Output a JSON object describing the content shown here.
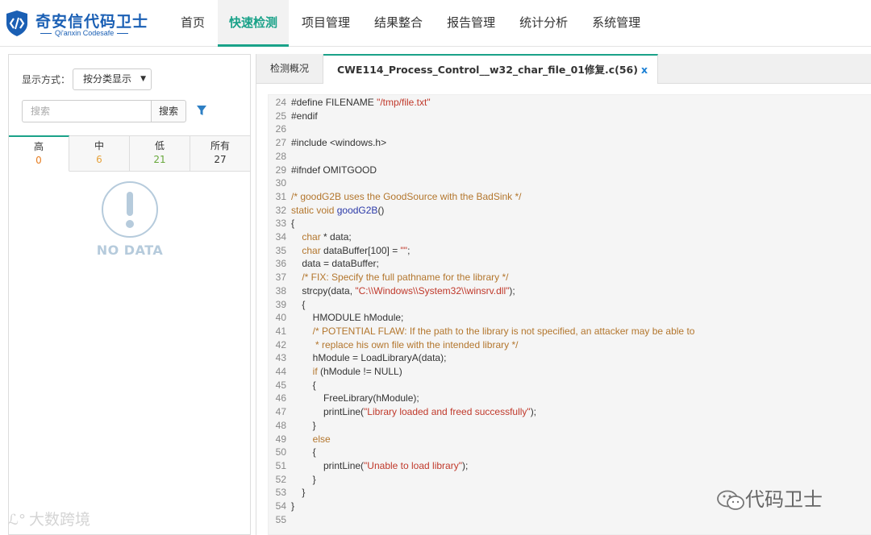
{
  "app": {
    "title": "奇安信代码卫士",
    "subtitle": "Qi'anxin Codesafe"
  },
  "nav": {
    "items": [
      "首页",
      "快速检测",
      "项目管理",
      "结果整合",
      "报告管理",
      "统计分析",
      "系统管理"
    ],
    "active_index": 1
  },
  "left": {
    "display_label": "显示方式：",
    "display_value": "按分类显示",
    "search_placeholder": "搜索",
    "search_button": "搜索",
    "severity_tabs": [
      {
        "label": "高",
        "count": "0",
        "color": "#e67e22"
      },
      {
        "label": "中",
        "count": "6",
        "color": "#e6a23c"
      },
      {
        "label": "低",
        "count": "21",
        "color": "#67a83a"
      },
      {
        "label": "所有",
        "count": "27",
        "color": "#333333"
      }
    ],
    "nodata_text": "NO DATA"
  },
  "tabs": {
    "overview": "检测概况",
    "file_tab": "CWE114_Process_Control__w32_char_file_01修复.c(56)",
    "close": "x"
  },
  "code": {
    "lines": [
      {
        "n": "24",
        "t": "#define FILENAME \"/tmp/file.txt\""
      },
      {
        "n": "25",
        "t": "#endif"
      },
      {
        "n": "26",
        "t": ""
      },
      {
        "n": "27",
        "t": "#include <windows.h>"
      },
      {
        "n": "28",
        "t": ""
      },
      {
        "n": "29",
        "t": "#ifndef OMITGOOD"
      },
      {
        "n": "30",
        "t": ""
      },
      {
        "n": "31",
        "t": "/* goodG2B uses the GoodSource with the BadSink */"
      },
      {
        "n": "32",
        "t": "static void goodG2B()"
      },
      {
        "n": "33",
        "t": "{"
      },
      {
        "n": "34",
        "t": "    char * data;"
      },
      {
        "n": "35",
        "t": "    char dataBuffer[100] = \"\";"
      },
      {
        "n": "36",
        "t": "    data = dataBuffer;"
      },
      {
        "n": "37",
        "t": "    /* FIX: Specify the full pathname for the library */"
      },
      {
        "n": "38",
        "t": "    strcpy(data, \"C:\\\\Windows\\\\System32\\\\winsrv.dll\");"
      },
      {
        "n": "39",
        "t": "    {"
      },
      {
        "n": "40",
        "t": "        HMODULE hModule;"
      },
      {
        "n": "41",
        "t": "        /* POTENTIAL FLAW: If the path to the library is not specified, an attacker may be able to"
      },
      {
        "n": "42",
        "t": "         * replace his own file with the intended library */"
      },
      {
        "n": "43",
        "t": "        hModule = LoadLibraryA(data);"
      },
      {
        "n": "44",
        "t": "        if (hModule != NULL)"
      },
      {
        "n": "45",
        "t": "        {"
      },
      {
        "n": "46",
        "t": "            FreeLibrary(hModule);"
      },
      {
        "n": "47",
        "t": "            printLine(\"Library loaded and freed successfully\");"
      },
      {
        "n": "48",
        "t": "        }"
      },
      {
        "n": "49",
        "t": "        else"
      },
      {
        "n": "50",
        "t": "        {"
      },
      {
        "n": "51",
        "t": "            printLine(\"Unable to load library\");"
      },
      {
        "n": "52",
        "t": "        }"
      },
      {
        "n": "53",
        "t": "    }"
      },
      {
        "n": "54",
        "t": "}"
      },
      {
        "n": "55",
        "t": ""
      }
    ]
  },
  "watermarks": {
    "left": "大数跨境",
    "right": "代码卫士"
  },
  "colors": {
    "accent": "#1aa289",
    "brand": "#1a5fb4"
  }
}
